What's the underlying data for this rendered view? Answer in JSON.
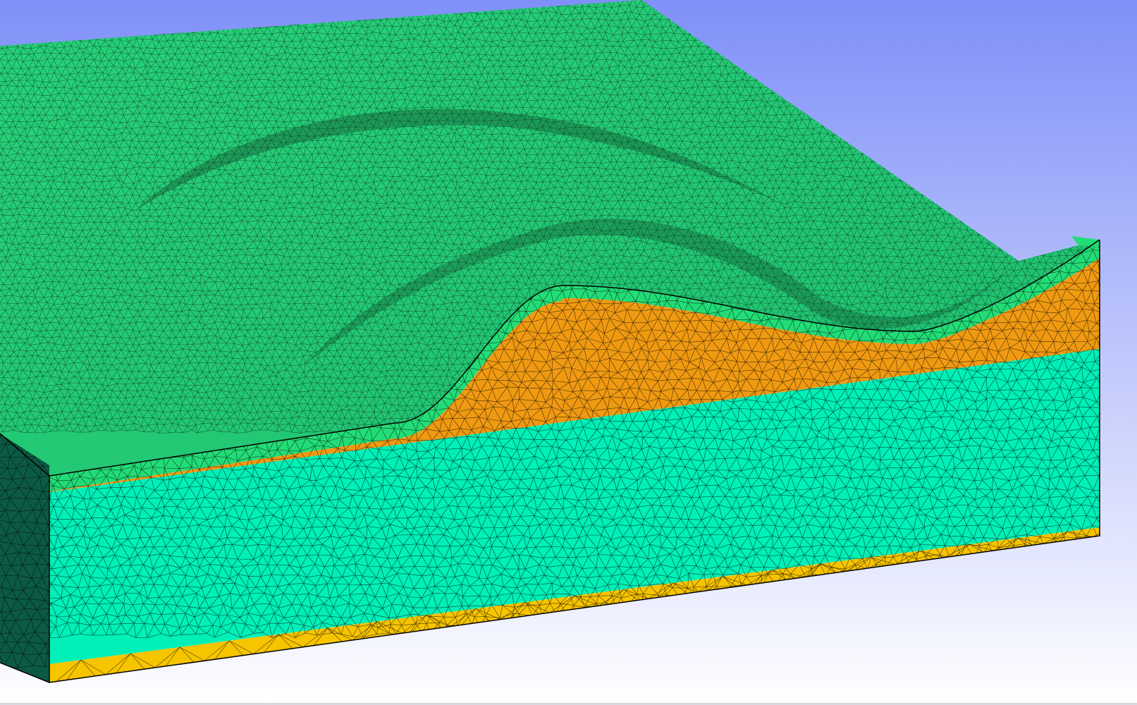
{
  "viewer": {
    "background_top": "#7f90f8",
    "background_bottom": "#ffffff"
  },
  "mesh": {
    "element_type": "tetrahedral",
    "wireframe_color": "#000000",
    "layers": [
      {
        "name": "top-surface",
        "color": "#22dd77"
      },
      {
        "name": "upper-layer",
        "color": "#f09a12"
      },
      {
        "name": "middle-layer",
        "color": "#00f0b8"
      },
      {
        "name": "base-layer",
        "color": "#f7c400"
      },
      {
        "name": "side-face-shaded",
        "color": "#0c5a44"
      }
    ]
  }
}
